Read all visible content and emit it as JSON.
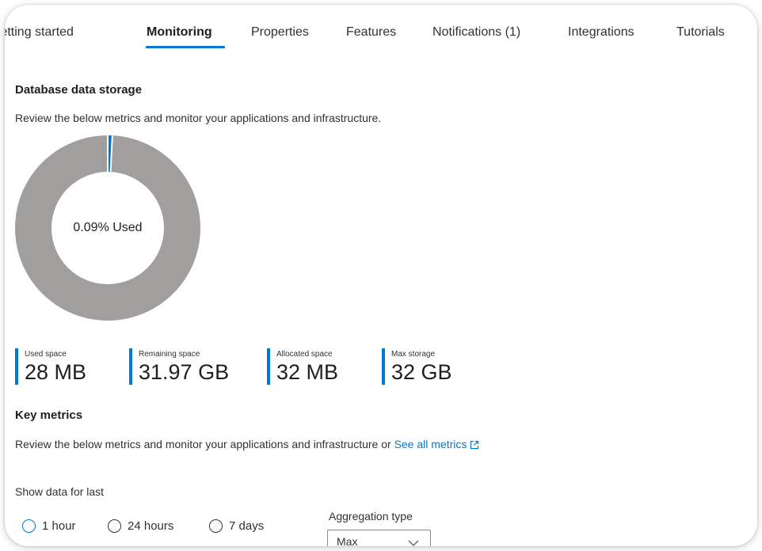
{
  "tabs": [
    {
      "label": "Getting started",
      "active": false
    },
    {
      "label": "Monitoring",
      "active": true
    },
    {
      "label": "Properties",
      "active": false
    },
    {
      "label": "Features",
      "active": false
    },
    {
      "label": "Notifications (1)",
      "active": false
    },
    {
      "label": "Integrations",
      "active": false
    },
    {
      "label": "Tutorials",
      "active": false
    }
  ],
  "storage": {
    "title": "Database data storage",
    "description": "Review the below metrics and monitor your applications and infrastructure.",
    "donut": {
      "used_percent": 0.09,
      "label": "0.09% Used",
      "used_color": "#0078d4",
      "remaining_color": "#a19f9d"
    },
    "metrics": [
      {
        "label": "Used space",
        "value": "28 MB"
      },
      {
        "label": "Remaining space",
        "value": "31.97 GB"
      },
      {
        "label": "Allocated space",
        "value": "32 MB"
      },
      {
        "label": "Max storage",
        "value": "32 GB"
      }
    ]
  },
  "key_metrics": {
    "title": "Key metrics",
    "description": "Review the below metrics and monitor your applications and infrastructure or",
    "link_text": "See all metrics",
    "link_icon": "external-link-icon"
  },
  "filters": {
    "show_data_label": "Show data for last",
    "time_options": [
      {
        "label": "1 hour",
        "selected": true
      },
      {
        "label": "24 hours",
        "selected": false
      },
      {
        "label": "7 days",
        "selected": false
      }
    ],
    "aggregation_label": "Aggregation type",
    "aggregation_value": "Max"
  },
  "colors": {
    "accent": "#0078d4"
  }
}
